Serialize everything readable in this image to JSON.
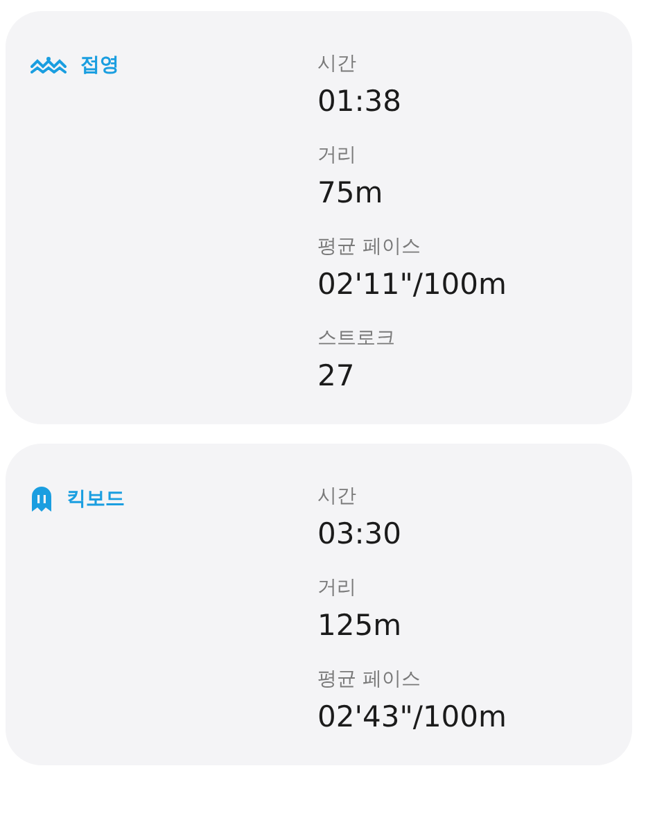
{
  "sessions": [
    {
      "kind": "stroke",
      "name": "접영",
      "stats": [
        {
          "label": "시간",
          "value": "01:38"
        },
        {
          "label": "거리",
          "value": "75m"
        },
        {
          "label": "평균 페이스",
          "value": "02'11\"/100m"
        },
        {
          "label": "스트로크",
          "value": "27"
        }
      ]
    },
    {
      "kind": "kickboard",
      "name": "킥보드",
      "stats": [
        {
          "label": "시간",
          "value": "03:30"
        },
        {
          "label": "거리",
          "value": "125m"
        },
        {
          "label": "평균 페이스",
          "value": "02'43\"/100m"
        }
      ]
    }
  ]
}
